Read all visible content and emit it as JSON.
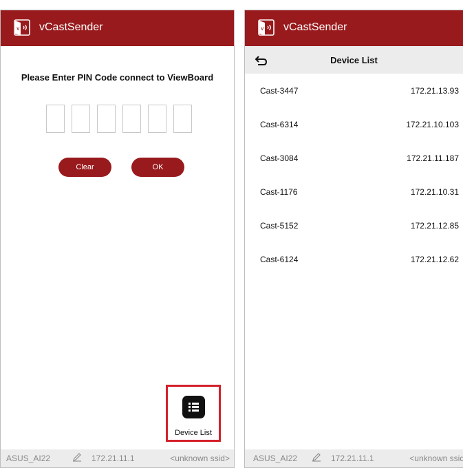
{
  "app": {
    "title": "vCastSender",
    "brand_color": "#991a1d"
  },
  "pin_screen": {
    "prompt": "Please Enter PIN Code connect to ViewBoard",
    "clear_label": "Clear",
    "ok_label": "OK",
    "device_list_label": "Device List"
  },
  "status_bar": {
    "device_name": "ASUS_AI22",
    "ip": "172.21.11.1",
    "ssid_left": "<unknown ssid>",
    "ssid_right": "<unknown ssid"
  },
  "device_list_screen": {
    "title": "Device List",
    "devices": [
      {
        "name": "Cast-3447",
        "ip": "172.21.13.93"
      },
      {
        "name": "Cast-6314",
        "ip": "172.21.10.103"
      },
      {
        "name": "Cast-3084",
        "ip": "172.21.11.187"
      },
      {
        "name": "Cast-1176",
        "ip": "172.21.10.31"
      },
      {
        "name": "Cast-5152",
        "ip": "172.21.12.85"
      },
      {
        "name": "Cast-6124",
        "ip": "172.21.12.62"
      }
    ]
  },
  "icons": [
    "vcast-logo-icon",
    "pencil-edit-icon",
    "list-icon",
    "back-arrow-icon"
  ]
}
